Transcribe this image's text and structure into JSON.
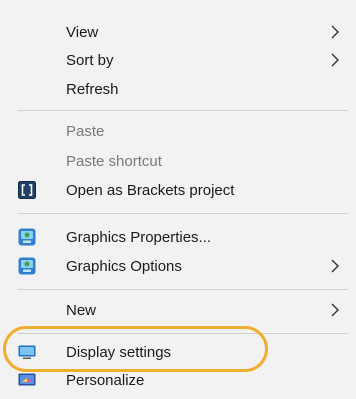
{
  "context_menu": {
    "items": [
      {
        "label": "View",
        "has_submenu": true,
        "disabled": false,
        "icon": ""
      },
      {
        "label": "Sort by",
        "has_submenu": true,
        "disabled": false,
        "icon": ""
      },
      {
        "label": "Refresh",
        "has_submenu": false,
        "disabled": false,
        "icon": ""
      },
      {
        "label": "Paste",
        "has_submenu": false,
        "disabled": true,
        "icon": ""
      },
      {
        "label": "Paste shortcut",
        "has_submenu": false,
        "disabled": true,
        "icon": ""
      },
      {
        "label": "Open as Brackets project",
        "has_submenu": false,
        "disabled": false,
        "icon": "brackets-icon"
      },
      {
        "label": "Graphics Properties...",
        "has_submenu": false,
        "disabled": false,
        "icon": "intel-graphics-icon"
      },
      {
        "label": "Graphics Options",
        "has_submenu": true,
        "disabled": false,
        "icon": "intel-graphics-icon"
      },
      {
        "label": "New",
        "has_submenu": true,
        "disabled": false,
        "icon": ""
      },
      {
        "label": "Display settings",
        "has_submenu": false,
        "disabled": false,
        "icon": "display-icon",
        "highlighted": true
      },
      {
        "label": "Personalize",
        "has_submenu": false,
        "disabled": false,
        "icon": "personalize-icon"
      }
    ]
  },
  "colors": {
    "menu_background": "#f2f2f2",
    "highlight_ring": "#f0ad2e",
    "disabled_text": "#7a7a7a"
  }
}
